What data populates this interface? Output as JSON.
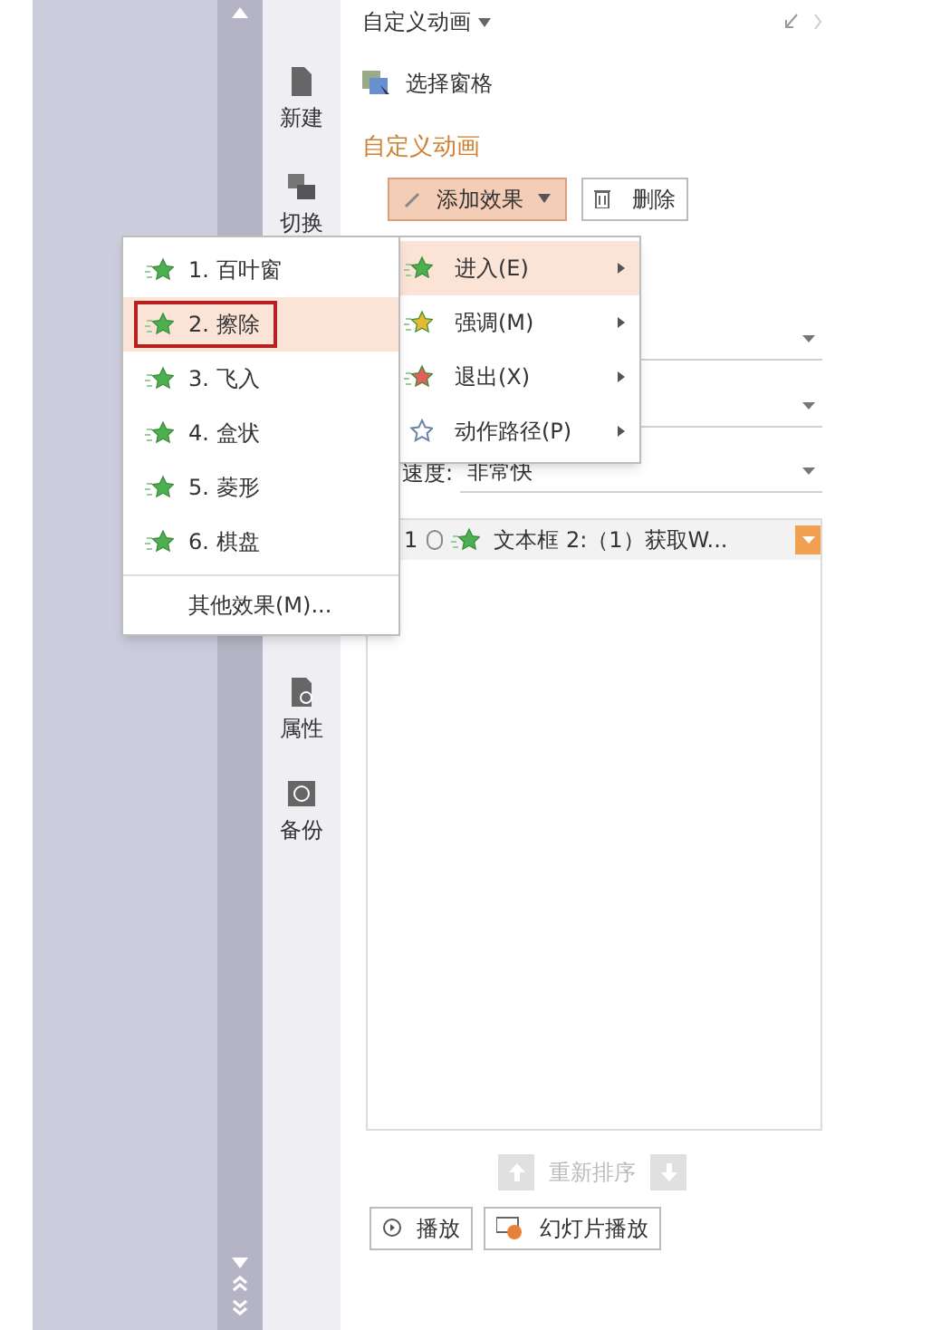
{
  "sidebar": {
    "items": [
      {
        "label": "新建"
      },
      {
        "label": "切换"
      },
      {
        "label": "属性"
      },
      {
        "label": "备份"
      }
    ]
  },
  "panel": {
    "title": "自定义动画",
    "select_pane": "选择窗格",
    "section_title": "自定义动画",
    "add_effect": {
      "label": "添加效果",
      "pressed": true
    },
    "delete": {
      "label": "删除"
    },
    "speed": {
      "label": "速度:",
      "value": "非常快"
    },
    "animation_list": [
      {
        "order": "1",
        "name": "文本框 2:（1）获取W...",
        "selected": true
      }
    ],
    "reorder": "重新排序",
    "buttons": [
      {
        "label": "播放",
        "kind": "play"
      },
      {
        "label": "幻灯片播放",
        "kind": "slideshow"
      }
    ]
  },
  "effect_submenu": [
    {
      "label": "进入(E)",
      "kind": "filled",
      "color": "#4caf50",
      "selected": true
    },
    {
      "label": "强调(M)",
      "kind": "filled",
      "color": "#e8b830",
      "selected": false
    },
    {
      "label": "退出(X)",
      "kind": "filled",
      "color": "#e0605a",
      "selected": false
    },
    {
      "label": "动作路径(P)",
      "kind": "outline",
      "color": "#6a84a8",
      "selected": false
    }
  ],
  "entrance_menu": {
    "items": [
      {
        "label": "1. 百叶窗",
        "selected": false
      },
      {
        "label": "2. 擦除",
        "selected": true
      },
      {
        "label": "3. 飞入",
        "selected": false
      },
      {
        "label": "4. 盒状",
        "selected": false
      },
      {
        "label": "5. 菱形",
        "selected": false
      },
      {
        "label": "6. 棋盘",
        "selected": false
      }
    ],
    "more": "其他效果(M)..."
  }
}
